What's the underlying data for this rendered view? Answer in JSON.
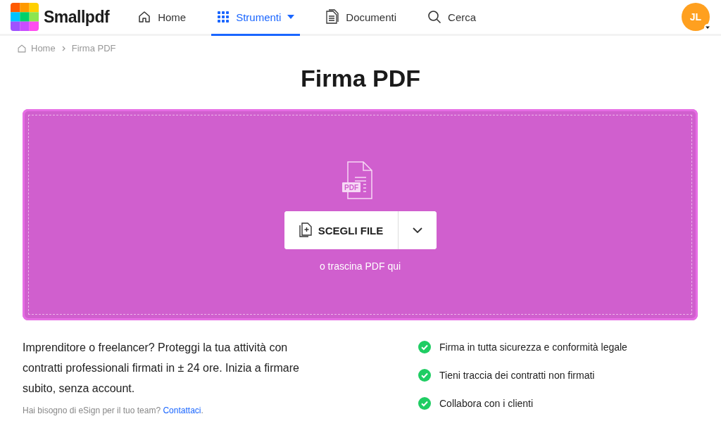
{
  "header": {
    "logo": "Smallpdf",
    "nav": [
      {
        "kind": "home",
        "label": "Home",
        "selected": false
      },
      {
        "kind": "tools",
        "label": "Strumenti",
        "selected": true
      },
      {
        "kind": "documents",
        "label": "Documenti",
        "selected": false
      },
      {
        "kind": "search",
        "label": "Cerca",
        "selected": false
      }
    ],
    "avatar": "JL"
  },
  "breadcrumb": [
    "Home",
    "Firma PDF"
  ],
  "title": "Firma PDF",
  "dropzone": {
    "file_badge": "PDF",
    "button": "SCEGLI FILE",
    "hint": "o trascina PDF qui"
  },
  "intro": "Imprenditore o freelancer? Proteggi la tua attività con contratti professionali firmati in ± 24 ore. Inizia a firmare subito, senza account.",
  "team_note": {
    "text": "Hai bisogno di eSign per il tuo team?",
    "link": "Contattaci",
    "after": "."
  },
  "features": [
    "Firma in tutta sicurezza e conformità legale",
    "Tieni traccia dei contratti non firmati",
    "Collabora con i clienti"
  ]
}
